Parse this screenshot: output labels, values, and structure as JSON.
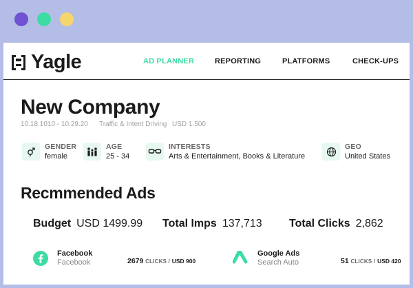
{
  "window_controls": {
    "close_color": "#6e52d3",
    "minimize_color": "#3ddca2",
    "maximize_color": "#f5d66c"
  },
  "brand": {
    "name": "Yagle"
  },
  "nav": {
    "items": [
      {
        "label": "AD PLANNER",
        "active": true
      },
      {
        "label": "REPORTING",
        "active": false
      },
      {
        "label": "PLATFORMS",
        "active": false
      },
      {
        "label": "CHECK-UPS",
        "active": false
      }
    ],
    "accent_color": "#3ddca2"
  },
  "campaign": {
    "title": "New Company",
    "date_range": "10.18.1010 - 10.29.20",
    "objective": "Traffic & Intent Driving",
    "budget": "USD 1.500"
  },
  "targeting": [
    {
      "icon": "gender-icon",
      "label": "GENDER",
      "value": "female"
    },
    {
      "icon": "age-group-icon",
      "label": "AGE",
      "value": "25 - 34"
    },
    {
      "icon": "glasses-icon",
      "label": "INTERESTS",
      "value": "Arts & Entertainment, Books & Literature"
    },
    {
      "icon": "globe-icon",
      "label": "GEO",
      "value": "United States"
    }
  ],
  "recommended": {
    "title": "Recmmended Ads",
    "budget_label": "Budget",
    "budget_value": "USD 1499.99",
    "imps_label": "Total Imps",
    "imps_value": "137,713",
    "clicks_label": "Total Clicks",
    "clicks_value": "2,862"
  },
  "ads": [
    {
      "icon": "facebook-icon",
      "name": "Facebook",
      "subtitle": "Facebook",
      "clicks": "2679",
      "clicks_unit": "CLICKS /",
      "spend": "USD 900"
    },
    {
      "icon": "google-ads-icon",
      "name": "Google Ads",
      "subtitle": "Search Auto",
      "clicks": "51",
      "clicks_unit": "CLICKS /",
      "spend": "USD 420"
    }
  ]
}
